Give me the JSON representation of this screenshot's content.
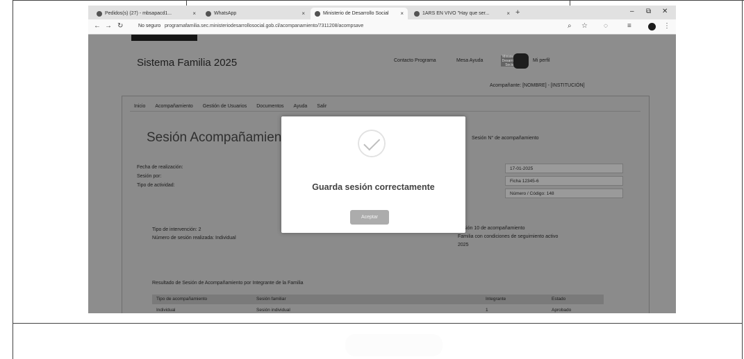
{
  "browser": {
    "tabs": [
      {
        "label": "Pedidos(s) (27) - mbsapacd1...",
        "active": false
      },
      {
        "label": "WhatsApp",
        "active": false
      },
      {
        "label": "Ministerio de Desarrollo Social",
        "active": true
      },
      {
        "label": "1ARS EN VIVO \"Hay que ser...",
        "active": false
      }
    ],
    "not_secure_label": "No seguro",
    "url": "programafamilia.sec.ministeriodesarrollosocial.gob.cl/acompanamiento/7311208/acompsave",
    "icons": [
      "back-icon",
      "forward-icon",
      "reload-icon",
      "zoom-icon",
      "star-icon",
      "extensions-icon",
      "sidebar-icon",
      "profile-icon",
      "menu-icon"
    ]
  },
  "app": {
    "title": "Sistema Familia 2025",
    "header_links": [
      "Contacto Programa",
      "Mesa Ayuda"
    ],
    "gov_logo_text": "Ministerio Desarrollo Social",
    "user_link": "Mi perfil",
    "user_line": "Acompañante: [NOMBRE] - [INSTITUCIÓN]",
    "menu": [
      "Inicio",
      "Acompañamiento",
      "Gestión de Usuarios",
      "Documentos",
      "Ayuda",
      "Salir"
    ],
    "section_title": "Sesión Acompañamiento",
    "side_info": "Sesión N° de acompañamiento",
    "left_labels": [
      "Fecha de realización:",
      "Sesión por:",
      "Tipo de actividad:"
    ],
    "right_boxes": [
      "17-01-2025",
      "Ficha 12345-6",
      "Número / Código: 148"
    ],
    "mid_labels": [
      "Tipo de intervención: 2",
      "Número de sesión realizada: Individual"
    ],
    "mid_right_labels": [
      "Sesión 10 de acompañamiento",
      "Familia con condiciones de seguimiento activo",
      "2025"
    ],
    "table_caption": "Resultado de Sesión de Acompañamiento por Integrante de la Familia",
    "table_headers": [
      "Tipo de acompañamiento",
      "Sesión familiar",
      "Integrante",
      "Estado"
    ],
    "table_row": [
      "Individual",
      "Sesión individual",
      "1",
      "Aprobado"
    ]
  },
  "modal": {
    "icon": "check-icon",
    "message": "Guarda sesión correctamente",
    "button_label": "Aceptar"
  }
}
